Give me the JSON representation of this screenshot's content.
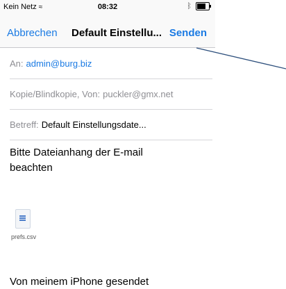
{
  "status_bar": {
    "carrier": "Kein Netz",
    "time": "08:32"
  },
  "nav": {
    "cancel_label": "Abbrechen",
    "title": "Default Einstellu...",
    "send_label": "Senden"
  },
  "fields": {
    "to_label": "An:",
    "to_value": "admin@burg.biz",
    "cc_label": "Kopie/Blindkopie, Von:",
    "cc_value": "puckler@gmx.net",
    "subject_label": "Betreff:",
    "subject_value": "Default Einstellungsdate..."
  },
  "body": {
    "text": "Bitte Dateianhang der E-mail beachten",
    "attachment_name": "prefs.csv",
    "signature": "Von meinem iPhone gesendet"
  },
  "colors": {
    "accent": "#1a7ae3",
    "annotation_arrow": "#2d4f7c"
  }
}
